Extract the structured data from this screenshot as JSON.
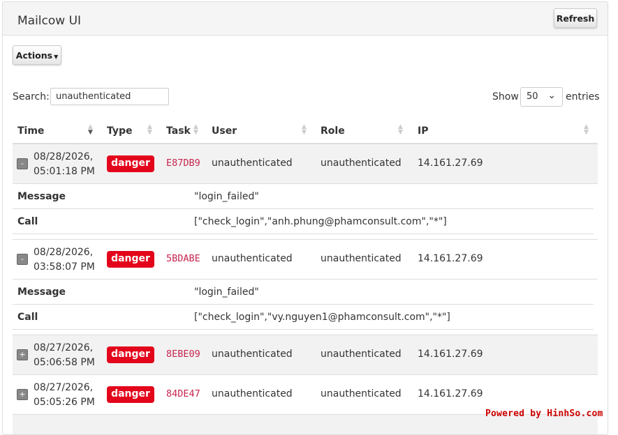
{
  "header": {
    "title": "Mailcow UI",
    "refresh_label": "Refresh"
  },
  "toolbar": {
    "actions_label": "Actions"
  },
  "search": {
    "label": "Search:",
    "value": "unauthenticated"
  },
  "length": {
    "show_label": "Show",
    "value": "50",
    "entries_label": "entries"
  },
  "columns": [
    "Time",
    "Type",
    "Task",
    "User",
    "Role",
    "IP"
  ],
  "rows": [
    {
      "toggle": "-",
      "time_line1": "08/28/2026,",
      "time_line2": "05:01:18 PM",
      "type": "danger",
      "task": "E87DB9",
      "user": "unauthenticated",
      "role": "unauthenticated",
      "ip": "14.161.27.69",
      "details": {
        "message_key": "Message",
        "message_val": "\"login_failed\"",
        "call_key": "Call",
        "call_val": "[\"check_login\",\"anh.phung@phamconsult.com\",\"*\"]"
      }
    },
    {
      "toggle": "-",
      "time_line1": "08/28/2026,",
      "time_line2": "03:58:07 PM",
      "type": "danger",
      "task": "5BDABE",
      "user": "unauthenticated",
      "role": "unauthenticated",
      "ip": "14.161.27.69",
      "details": {
        "message_key": "Message",
        "message_val": "\"login_failed\"",
        "call_key": "Call",
        "call_val": "[\"check_login\",\"vy.nguyen1@phamconsult.com\",\"*\"]"
      }
    },
    {
      "toggle": "+",
      "time_line1": "08/27/2026,",
      "time_line2": "05:06:58 PM",
      "type": "danger",
      "task": "8EBE09",
      "user": "unauthenticated",
      "role": "unauthenticated",
      "ip": "14.161.27.69"
    },
    {
      "toggle": "+",
      "time_line1": "08/27/2026,",
      "time_line2": "05:05:26 PM",
      "type": "danger",
      "task": "84DE47",
      "user": "unauthenticated",
      "role": "unauthenticated",
      "ip": "14.161.27.69"
    }
  ],
  "watermark": "Powered by HinhSo.com",
  "colors": {
    "danger": "#e3051b",
    "task_code": "#c7254e",
    "stripe": "#f2f2f2"
  }
}
